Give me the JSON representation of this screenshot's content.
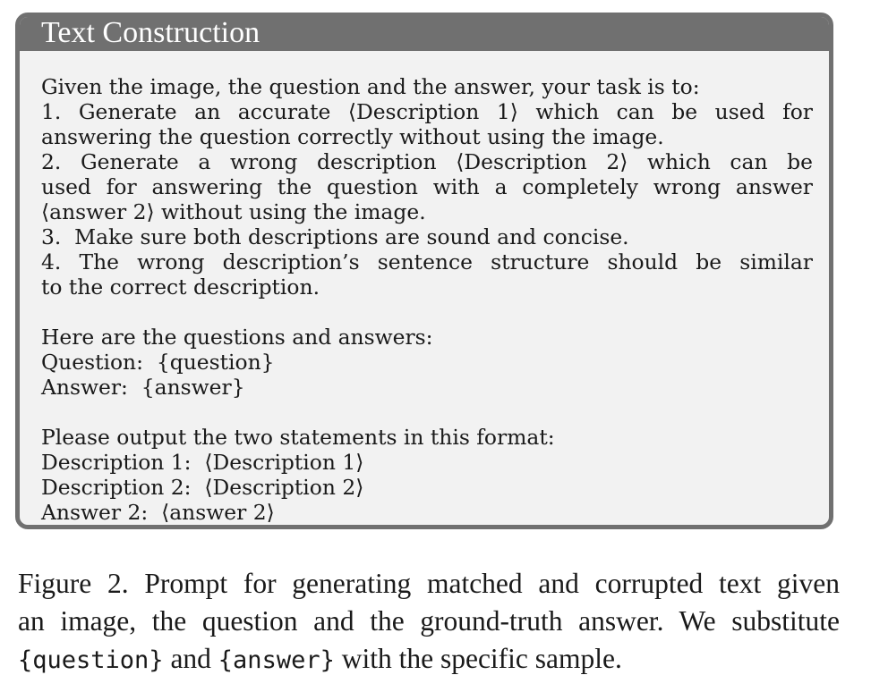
{
  "box": {
    "title": "Text Construction",
    "lines": [
      "Given the image, the question and the answer, your task is to:",
      "1.  Generate an accurate ⟨Description 1⟩ which can be used for",
      "answering the question correctly without using the image.",
      "2.  Generate a wrong description ⟨Description 2⟩ which can be",
      "used for answering the question with a completely wrong answer",
      "⟨answer 2⟩ without using the image.",
      "3.  Make sure both descriptions are sound and concise.",
      "4.  The wrong description’s sentence structure should be similar",
      "to the correct description.",
      "Here are the questions and answers:",
      "Question:  {question}",
      "Answer:  {answer}",
      "Please output the two statements in this format:",
      "Description 1:  ⟨Description 1⟩",
      "Description 2:  ⟨Description 2⟩",
      "Answer 2:  ⟨answer 2⟩"
    ]
  },
  "caption": {
    "line1": "Figure 2. Prompt for generating matched and corrupted text given",
    "line2": "an image, the question and the ground-truth answer. We substitute",
    "line3_code1": "{question}",
    "line3_and": " and ",
    "line3_code2": "{answer}",
    "line3_rest": " with the specific sample."
  }
}
